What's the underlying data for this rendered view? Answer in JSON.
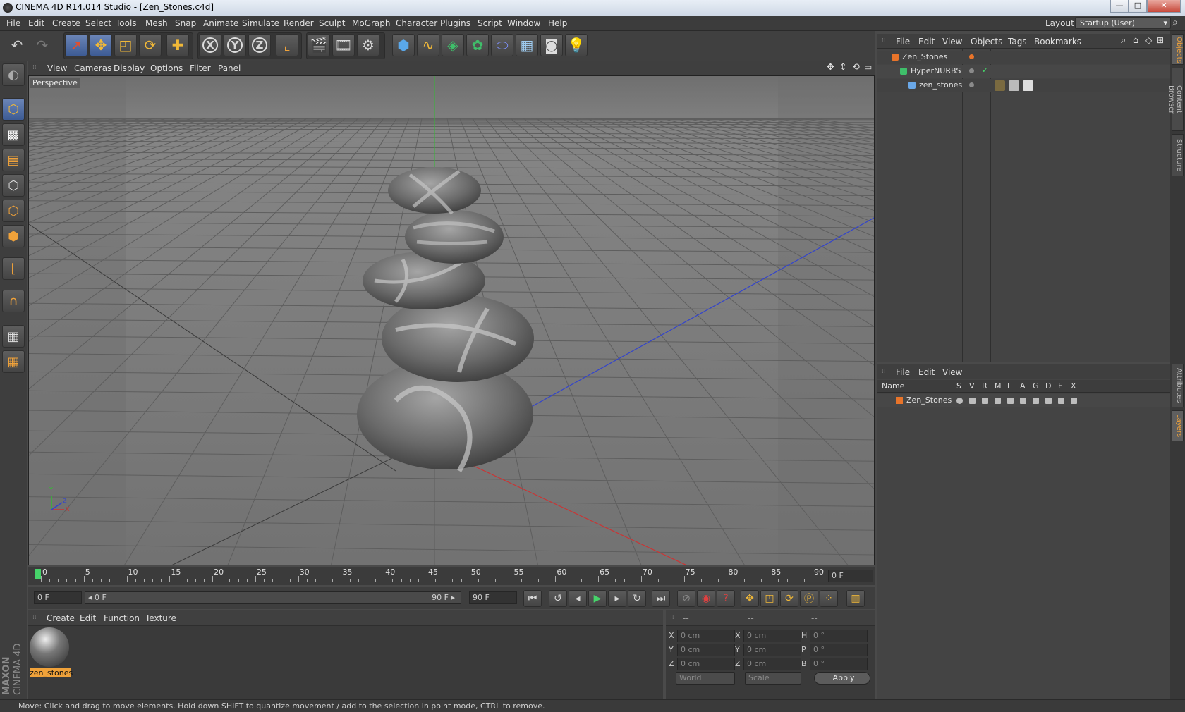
{
  "window": {
    "title": "CINEMA 4D R14.014 Studio - [Zen_Stones.c4d]",
    "minimize": "—",
    "maximize": "□",
    "close": "✕"
  },
  "menu": [
    "File",
    "Edit",
    "Create",
    "Select",
    "Tools",
    "Mesh",
    "Snap",
    "Animate",
    "Simulate",
    "Render",
    "Sculpt",
    "MoGraph",
    "Character",
    "Plugins",
    "Script",
    "Window",
    "Help"
  ],
  "layout": {
    "label": "Layout:",
    "value": "Startup (User)"
  },
  "toolbar": {
    "x_label": "X",
    "y_label": "Y",
    "z_label": "Z"
  },
  "viewport": {
    "menu": [
      "View",
      "Cameras",
      "Display",
      "Options",
      "Filter",
      "Panel"
    ],
    "label": "Perspective",
    "axis": {
      "y": "Y",
      "x": "X",
      "z": "Z"
    }
  },
  "timeline": {
    "ticks": [
      "0",
      "5",
      "10",
      "15",
      "20",
      "25",
      "30",
      "35",
      "40",
      "45",
      "50",
      "55",
      "60",
      "65",
      "70",
      "75",
      "80",
      "85",
      "90"
    ],
    "current": "0 F"
  },
  "transport": {
    "start": "0 F",
    "range_start": "◂ 0 F",
    "range_end": "90 F ▸",
    "end": "90 F"
  },
  "material": {
    "menu": [
      "Create",
      "Edit",
      "Function",
      "Texture"
    ],
    "items": [
      {
        "name": "zen_stones"
      }
    ]
  },
  "coords": {
    "headers": [
      "--",
      "--",
      "--"
    ],
    "rows": [
      {
        "a": "X",
        "av": "0 cm",
        "b": "X",
        "bv": "0 cm",
        "c": "H",
        "cv": "0 °"
      },
      {
        "a": "Y",
        "av": "0 cm",
        "b": "Y",
        "bv": "0 cm",
        "c": "P",
        "cv": "0 °"
      },
      {
        "a": "Z",
        "av": "0 cm",
        "b": "Z",
        "bv": "0 cm",
        "c": "B",
        "cv": "0 °"
      }
    ],
    "mode1": "World",
    "mode2": "Scale",
    "apply": "Apply"
  },
  "status": "Move: Click and drag to move elements. Hold down SHIFT to quantize movement / add to the selection in point mode, CTRL to remove.",
  "objects": {
    "menu": [
      "File",
      "Edit",
      "View",
      "Objects",
      "Tags",
      "Bookmarks"
    ],
    "tree": [
      {
        "name": "Zen_Stones",
        "indent": 0,
        "color": "#e8742a"
      },
      {
        "name": "HyperNURBS",
        "indent": 1,
        "color": "#3fbf6a"
      },
      {
        "name": "zen_stones",
        "indent": 2,
        "color": "#6aa8e8"
      }
    ]
  },
  "layers": {
    "menu": [
      "File",
      "Edit",
      "View"
    ],
    "columns": [
      "Name",
      "S",
      "V",
      "R",
      "M",
      "L",
      "A",
      "G",
      "D",
      "E",
      "X"
    ],
    "rows": [
      {
        "name": "Zen_Stones",
        "color": "#e8742a"
      }
    ]
  },
  "side_tabs": [
    "Objects",
    "Content Browser",
    "Structure",
    "Attributes",
    "Layers"
  ],
  "logo": {
    "brand": "MAXON",
    "product": "CINEMA 4D"
  },
  "colors": {
    "accent": "#f0a23a",
    "select_blue": "#3d5b94",
    "x_axis": "#cc3333",
    "y_axis": "#33bb33",
    "z_axis": "#3344cc"
  }
}
